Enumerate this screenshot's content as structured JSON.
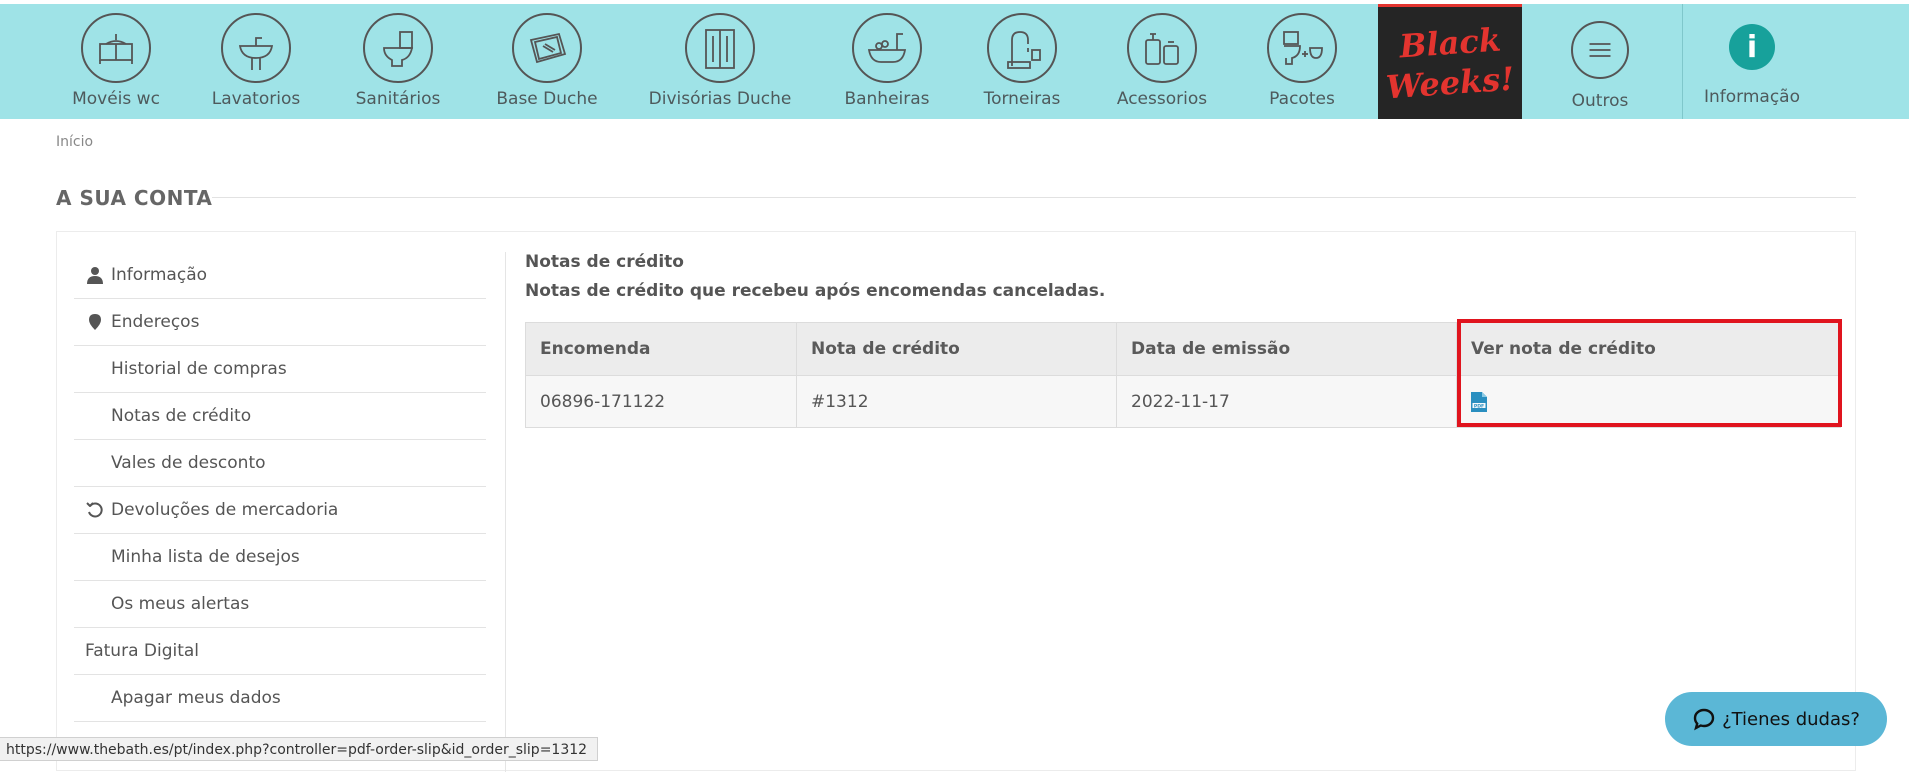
{
  "nav": {
    "items": [
      {
        "label": "Movéis wc",
        "icon": "vanity-cabinet-icon"
      },
      {
        "label": "Lavatorios",
        "icon": "washbasin-icon"
      },
      {
        "label": "Sanitários",
        "icon": "toilet-icon"
      },
      {
        "label": "Base Duche",
        "icon": "shower-tray-icon"
      },
      {
        "label": "Divisórias Duche",
        "icon": "shower-enclosure-icon"
      },
      {
        "label": "Banheiras",
        "icon": "bathtub-icon"
      },
      {
        "label": "Torneiras",
        "icon": "faucet-icon"
      },
      {
        "label": "Acessorios",
        "icon": "accessories-icon"
      },
      {
        "label": "Pacotes",
        "icon": "bundle-icon"
      }
    ],
    "promo": {
      "line1": "Black",
      "line2": "Weeks!"
    },
    "outros": "Outros",
    "informacao": "Informação",
    "colors": {
      "bar": "#9fe3e7",
      "promo_bg": "#252525",
      "promo_text": "#e3342f",
      "info": "#17a19b"
    }
  },
  "breadcrumb": "Início",
  "page_title": "A SUA CONTA",
  "sidebar": {
    "items": [
      {
        "label": "Informação",
        "icon": "user-icon"
      },
      {
        "label": "Endereços",
        "icon": "map-pin-icon"
      },
      {
        "label": "Historial de compras"
      },
      {
        "label": "Notas de crédito"
      },
      {
        "label": "Vales de desconto"
      },
      {
        "label": "Devoluções de mercadoria",
        "icon": "return-arrow-icon"
      },
      {
        "label": "Minha lista de desejos"
      },
      {
        "label": "Os meus alertas"
      },
      {
        "label": "Fatura Digital"
      },
      {
        "label": "Apagar meus dados"
      }
    ]
  },
  "content": {
    "title": "Notas de crédito",
    "description": "Notas de crédito que recebeu após encomendas canceladas.",
    "table": {
      "headers": [
        "Encomenda",
        "Nota de crédito",
        "Data de emissão",
        "Ver nota de crédito"
      ],
      "rows": [
        {
          "order": "06896-171122",
          "credit_note": "#1312",
          "date": "2022-11-17",
          "action_icon": "pdf-icon"
        }
      ]
    },
    "highlight_color": "#e0141e"
  },
  "status_url": "https://www.thebath.es/pt/index.php?controller=pdf-order-slip&id_order_slip=1312",
  "chat": {
    "label": "¿Tienes dudas?",
    "color": "#5bb7d6"
  }
}
